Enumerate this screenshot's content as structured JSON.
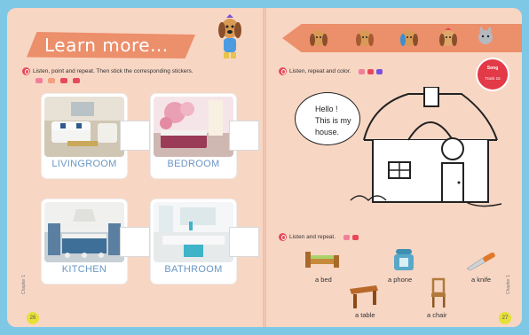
{
  "left_page": {
    "banner_title": "Learn more...",
    "instruction": "Listen, point and repeat. Then stick the corresponding stickers.",
    "rooms": [
      {
        "label": "LIVINGROOM"
      },
      {
        "label": "BEDROOM"
      },
      {
        "label": "KITCHEN"
      },
      {
        "label": "BATHROOM"
      }
    ],
    "page_number": "26",
    "chapter": "Chapter 1"
  },
  "right_page": {
    "instruction_color": "Listen, repeat and color.",
    "speech": [
      "Hello !",
      "This is my",
      "house."
    ],
    "instruction_listen": "Listen and repeat.",
    "vocabulary": [
      "a bed",
      "a phone",
      "a knife",
      "a table",
      "a chair"
    ],
    "song_badge": [
      "Song",
      "Track 15"
    ],
    "page_number": "27",
    "chapter": "Chapter 1"
  },
  "colors": {
    "page_bg": "#f8d6c4",
    "outer_bg": "#7ec8e6",
    "banner": "#ec8f6b",
    "label_blue": "#6a97c4",
    "page_number_badge": "#e6e03a"
  },
  "icons": [
    "speaker-icon",
    "dog-character-icon",
    "cat-character-icon",
    "bed-icon",
    "phone-icon",
    "knife-icon",
    "table-icon",
    "chair-icon",
    "house-drawing",
    "song-badge-icon"
  ]
}
